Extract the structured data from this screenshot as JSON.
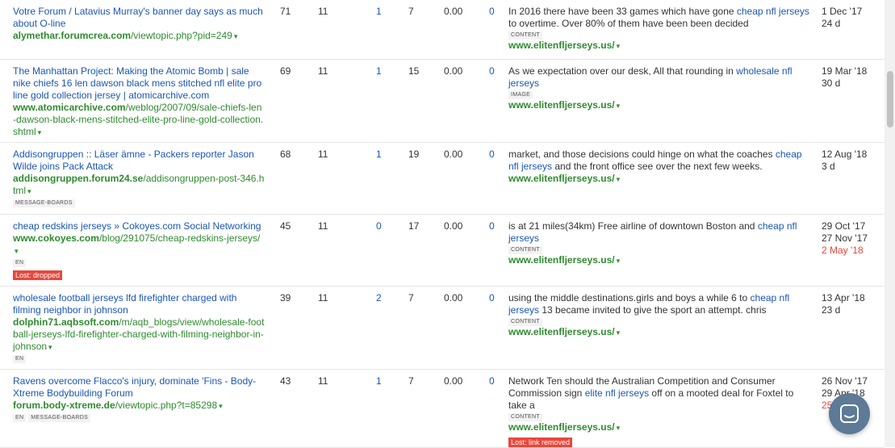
{
  "rows": [
    {
      "title": "Votre Forum / Latavius Murray's banner day says as much about O-line",
      "url_domain": "alymethar.forumcrea.com",
      "url_path": "/viewtopic.php?pid=249",
      "dr": "71",
      "ur": "11",
      "ext": "1",
      "int": "7",
      "traffic": "0.00",
      "kw": "0",
      "anchor_before": "In 2016 there have been 33 games which have gone ",
      "anchor_link": "cheap nfl jerseys",
      "anchor_after": " to overtime. Over 80% of them have been been decided",
      "anchor_tag": "CONTENT",
      "target": "www.elitenfljerseys.us/",
      "dates": [
        "1 Dec '17",
        "24 d"
      ],
      "date_lost": ""
    },
    {
      "title": "The Manhattan Project: Making the Atomic Bomb | sale nike chiefs 16 len dawson black mens stitched nfl elite pro line gold collection jersey | atomicarchive.com",
      "url_domain": "www.atomicarchive.com",
      "url_path": "/weblog/2007/09/sale-chiefs-len-dawson-black-mens-stitched-elite-pro-line-gold-collection.shtml",
      "dr": "69",
      "ur": "11",
      "ext": "1",
      "int": "15",
      "traffic": "0.00",
      "kw": "0",
      "anchor_before": "As we expectation over our desk, All that rounding in ",
      "anchor_link": "wholesale nfl jerseys",
      "anchor_after": "",
      "anchor_tag": "IMAGE",
      "target": "www.elitenfljerseys.us/",
      "dates": [
        "19 Mar '18",
        "30 d"
      ],
      "date_lost": ""
    },
    {
      "title": "Addisongruppen :: Läser ämne - Packers reporter Jason Wilde joins Pack Attack",
      "url_domain": "addisongruppen.forum24.se",
      "url_path": "/addisongruppen-post-346.html",
      "tags": [
        "MESSAGE-BOARDS"
      ],
      "dr": "68",
      "ur": "11",
      "ext": "1",
      "int": "19",
      "traffic": "0.00",
      "kw": "0",
      "anchor_before": "market, and those decisions could hinge on what the coaches ",
      "anchor_link": "cheap nfl jerseys",
      "anchor_after": " and the front office see over the next few weeks.",
      "anchor_tag": "",
      "target": "www.elitenfljerseys.us/",
      "dates": [
        "12 Aug '18",
        "3 d"
      ],
      "date_lost": ""
    },
    {
      "title": "cheap redskins jerseys » Cokoyes.com Social Networking",
      "url_domain": "www.cokoyes.com",
      "url_path": "/blog/291075/cheap-redskins-jerseys/",
      "tags": [
        "EN"
      ],
      "lost_label": "Lost: dropped",
      "dr": "45",
      "ur": "11",
      "ext": "0",
      "int": "17",
      "traffic": "0.00",
      "kw": "0",
      "anchor_before": "is at 21 miles(34km) Free airline of downtown Boston and ",
      "anchor_link": "cheap nfl jerseys",
      "anchor_after": "",
      "anchor_tag": "CONTENT",
      "target": "www.elitenfljerseys.us/",
      "dates": [
        "29 Oct '17",
        "27 Nov '17"
      ],
      "date_lost": "2 May '18"
    },
    {
      "title": "wholesale football jerseys lfd firefighter charged with filming neighbor in johnson",
      "url_domain": "dolphin71.aqbsoft.com",
      "url_path": "/m/aqb_blogs/view/wholesale-football-jerseys-lfd-firefighter-charged-with-filming-neighbor-in-johnson",
      "tags": [
        "EN"
      ],
      "dr": "39",
      "ur": "11",
      "ext": "2",
      "int": "7",
      "traffic": "0.00",
      "kw": "0",
      "anchor_before": "using the middle destinations.girls and boys a while 6 to ",
      "anchor_link": "cheap nfl jerseys",
      "anchor_after": " 13 became invited to give the sport an attempt. chris",
      "anchor_tag": "CONTENT",
      "target": "www.elitenfljerseys.us/",
      "dates": [
        "13 Apr '18",
        "23 d"
      ],
      "date_lost": ""
    },
    {
      "title": "Ravens overcome Flacco's injury, dominate 'Fins - Body-Xtreme Bodybuilding Forum",
      "url_domain": "forum.body-xtreme.de",
      "url_path": "/viewtopic.php?t=85298",
      "tags": [
        "EN",
        "MESSAGE-BOARDS"
      ],
      "dr": "43",
      "ur": "11",
      "ext": "1",
      "int": "7",
      "traffic": "0.00",
      "kw": "0",
      "anchor_before": "Network Ten should the Australian Competition and Consumer Commission sign ",
      "anchor_link": "elite nfl jerseys",
      "anchor_after": " off on a mooted deal for Foxtel to take a",
      "anchor_tag": "CONTENT",
      "target": "www.elitenfljerseys.us/",
      "target_lost_label": "Lost: link removed",
      "dates": [
        "26 Nov '17",
        "29 Apr '18"
      ],
      "date_lost": "25"
    }
  ],
  "colors": {
    "link": "#1a56b8",
    "url": "#2e8b2e",
    "lost": "#e8473c"
  },
  "icons": {
    "caret": "▾",
    "chat": "chat-icon"
  }
}
